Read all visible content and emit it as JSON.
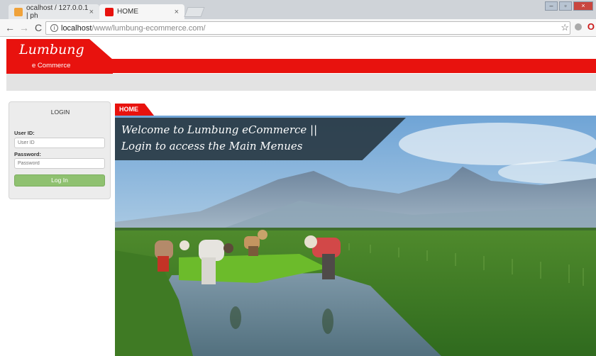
{
  "browser": {
    "tabs": [
      {
        "label": "ocalhost / 127.0.0.1 | ph",
        "active": false
      },
      {
        "label": "HOME",
        "active": true
      }
    ],
    "url_host": "localhost",
    "url_path": "/www/lumbung-ecommerce.com/"
  },
  "header": {
    "brand": "Lumbung",
    "tagline": "e Commerce"
  },
  "login": {
    "title": "LOGIN",
    "userid_label": "User ID:",
    "userid_placeholder": "User ID",
    "password_label": "Password:",
    "password_placeholder": "Password",
    "button": "Log In"
  },
  "main": {
    "section_label": "HOME",
    "welcome_line1": "Welcome to Lumbung eCommerce ||",
    "welcome_line2": "Login to access the Main Menues"
  },
  "colors": {
    "brand_red": "#e8120e",
    "login_button": "#8fc170"
  }
}
